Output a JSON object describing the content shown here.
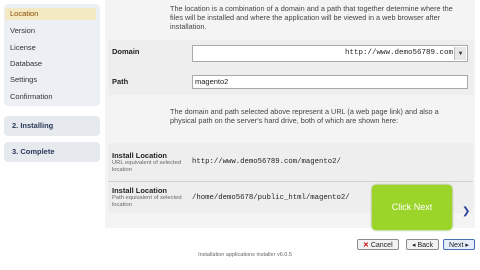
{
  "sidebar": {
    "items": [
      {
        "label": "Location",
        "active": true
      },
      {
        "label": "Version"
      },
      {
        "label": "License"
      },
      {
        "label": "Database"
      },
      {
        "label": "Settings"
      },
      {
        "label": "Confirmation"
      }
    ],
    "installing": "2. Installing",
    "complete": "3. Complete"
  },
  "main": {
    "intro": "The location is a combination of a domain and a path that together determine where the files will be installed and where the application will be viewed in a web browser after installation.",
    "domain_label": "Domain",
    "domain_value": "http://www.demo56789.com",
    "path_label": "Path",
    "path_value": "magento2",
    "explain": "The domain and path selected above represent a URL (a web page link) and also a physical path on the server's hard drive, both of which are shown here:",
    "install_loc_label": "Install Location",
    "install_loc_sub": "URL equivalent of selected location",
    "install_loc_value": "http://www.demo56789.com/magento2/",
    "install_path_label": "Install Location",
    "install_path_sub": "Path equivalent of selected location",
    "install_path_value": "/home/demo5678/public_html/magento2/"
  },
  "callout": "Click Next",
  "footer": "Installation applications installer v6.0.5",
  "buttons": {
    "cancel": "Cancel",
    "back": "Back",
    "next": "Next"
  }
}
